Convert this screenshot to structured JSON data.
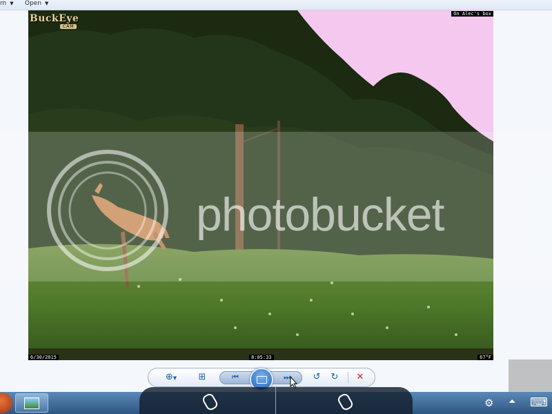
{
  "menubar": {
    "items": [
      {
        "label": "rn"
      },
      {
        "label": "Open"
      }
    ]
  },
  "photo": {
    "brand": "BuckEye",
    "brand_sub": "CAM",
    "camera_name": "On Alec's box",
    "date": "6/30/2015",
    "time": "8:05:33",
    "temperature": "67°F"
  },
  "watermark": "photobucket",
  "toolbar": {
    "buttons": [
      {
        "name": "zoom-button",
        "icon": "magnifier-zoom-icon",
        "glyph": "⊕"
      },
      {
        "name": "actual-size-button",
        "icon": "fit-to-window-icon",
        "glyph": "⊞"
      },
      {
        "name": "previous-button",
        "icon": "previous-icon",
        "glyph": "⏮"
      },
      {
        "name": "slideshow-button",
        "icon": "slideshow-icon"
      },
      {
        "name": "next-button",
        "icon": "next-icon",
        "glyph": "⏭"
      },
      {
        "name": "rotate-counterclockwise-button",
        "icon": "rotate-ccw-icon",
        "glyph": "↺"
      },
      {
        "name": "rotate-clockwise-button",
        "icon": "rotate-cw-icon",
        "glyph": "↻"
      },
      {
        "name": "delete-button",
        "icon": "delete-x-icon",
        "glyph": "✕"
      }
    ],
    "accent": "#1f5fa8",
    "delete_color": "#d11f1f"
  },
  "taskbar": {
    "tray": [
      {
        "icon": "settings-gear-icon",
        "glyph": "⚙"
      },
      {
        "icon": "show-hidden-icons-arrow",
        "glyph": "⏶"
      },
      {
        "icon": "keyboard-icon",
        "glyph": "⌨"
      }
    ]
  },
  "colors": {
    "sky": "#f5c8ef",
    "foliage_dark": "#1c2a12",
    "grass": "#5d8a33",
    "deer": "#c98a55"
  }
}
